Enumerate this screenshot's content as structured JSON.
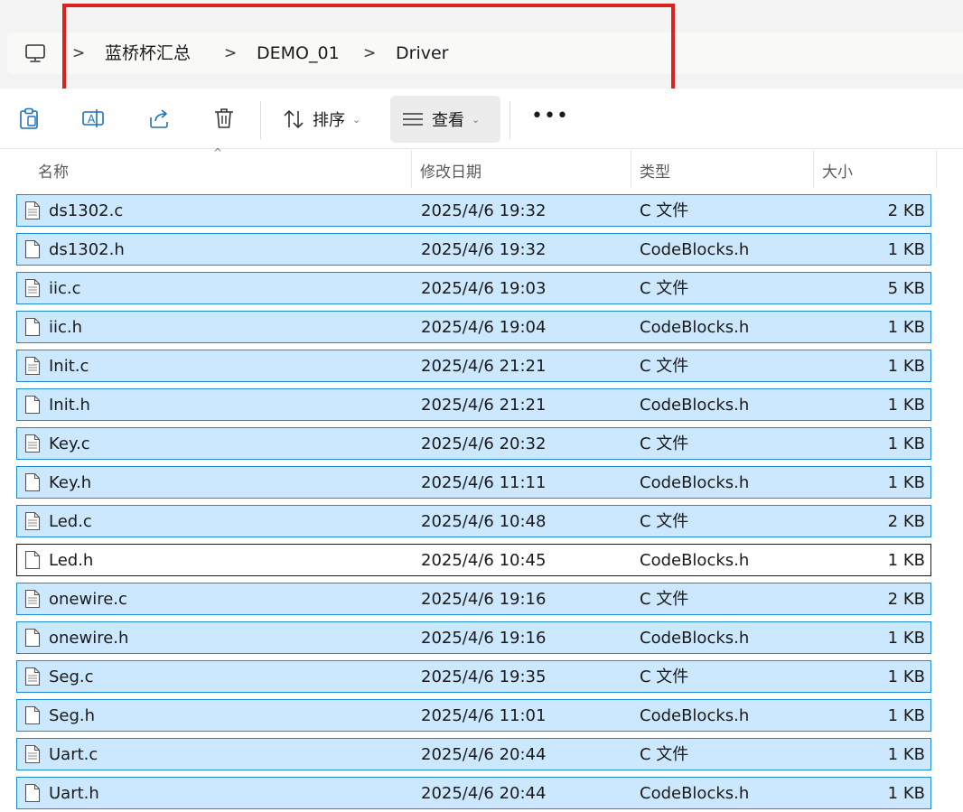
{
  "address": {
    "crumbs": [
      "蓝桥杯汇总",
      "DEMO_01",
      "Driver"
    ],
    "separator": ">",
    "root_icon": "this-pc-icon"
  },
  "toolbar": {
    "sort_label": "排序",
    "view_label": "查看",
    "more_label": "•••",
    "icons": [
      "paste-icon",
      "rename-icon",
      "share-icon",
      "delete-icon",
      "sort-icon",
      "view-icon"
    ]
  },
  "columns": {
    "name": "名称",
    "date": "修改日期",
    "type": "类型",
    "size": "大小",
    "sort_indicator": "^"
  },
  "files": [
    {
      "name": "ds1302.c",
      "date": "2025/4/6 19:32",
      "type": "C 文件",
      "size": "2 KB",
      "icon": "c-file-icon"
    },
    {
      "name": "ds1302.h",
      "date": "2025/4/6 19:32",
      "type": "CodeBlocks.h",
      "size": "1 KB",
      "icon": "h-file-icon"
    },
    {
      "name": "iic.c",
      "date": "2025/4/6 19:03",
      "type": "C 文件",
      "size": "5 KB",
      "icon": "c-file-icon"
    },
    {
      "name": "iic.h",
      "date": "2025/4/6 19:04",
      "type": "CodeBlocks.h",
      "size": "1 KB",
      "icon": "h-file-icon"
    },
    {
      "name": "Init.c",
      "date": "2025/4/6 21:21",
      "type": "C 文件",
      "size": "1 KB",
      "icon": "c-file-icon"
    },
    {
      "name": "Init.h",
      "date": "2025/4/6 21:21",
      "type": "CodeBlocks.h",
      "size": "1 KB",
      "icon": "h-file-icon"
    },
    {
      "name": "Key.c",
      "date": "2025/4/6 20:32",
      "type": "C 文件",
      "size": "1 KB",
      "icon": "c-file-icon"
    },
    {
      "name": "Key.h",
      "date": "2025/4/6 11:11",
      "type": "CodeBlocks.h",
      "size": "1 KB",
      "icon": "h-file-icon"
    },
    {
      "name": "Led.c",
      "date": "2025/4/6 10:48",
      "type": "C 文件",
      "size": "2 KB",
      "icon": "c-file-icon"
    },
    {
      "name": "Led.h",
      "date": "2025/4/6 10:45",
      "type": "CodeBlocks.h",
      "size": "1 KB",
      "icon": "h-file-icon",
      "focused": true
    },
    {
      "name": "onewire.c",
      "date": "2025/4/6 19:16",
      "type": "C 文件",
      "size": "2 KB",
      "icon": "c-file-icon"
    },
    {
      "name": "onewire.h",
      "date": "2025/4/6 19:16",
      "type": "CodeBlocks.h",
      "size": "1 KB",
      "icon": "h-file-icon"
    },
    {
      "name": "Seg.c",
      "date": "2025/4/6 19:35",
      "type": "C 文件",
      "size": "1 KB",
      "icon": "c-file-icon"
    },
    {
      "name": "Seg.h",
      "date": "2025/4/6 11:01",
      "type": "CodeBlocks.h",
      "size": "1 KB",
      "icon": "h-file-icon"
    },
    {
      "name": "Uart.c",
      "date": "2025/4/6 20:44",
      "type": "C 文件",
      "size": "1 KB",
      "icon": "c-file-icon"
    },
    {
      "name": "Uart.h",
      "date": "2025/4/6 20:44",
      "type": "CodeBlocks.h",
      "size": "1 KB",
      "icon": "h-file-icon"
    }
  ],
  "colors": {
    "selection_bg": "#cce8ff",
    "selection_border": "#1f8ad2",
    "annotation_red": "#e0201f"
  }
}
